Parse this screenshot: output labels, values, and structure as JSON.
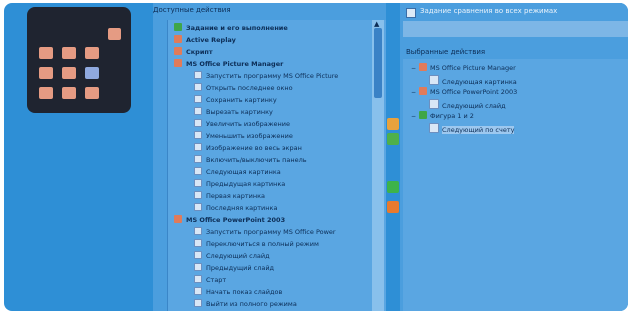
{
  "launcher": {
    "tiles": [
      {
        "name": "tile-1",
        "selected": false
      },
      {
        "name": "tile-2",
        "selected": false
      },
      {
        "name": "tile-3",
        "selected": false
      },
      {
        "name": "tile-4",
        "selected": false
      },
      {
        "name": "tile-5",
        "selected": false
      },
      {
        "name": "tile-6",
        "selected": true
      },
      {
        "name": "tile-7",
        "selected": false
      },
      {
        "name": "tile-8",
        "selected": false
      },
      {
        "name": "tile-9",
        "selected": false
      }
    ],
    "tile_color": "#e59b83",
    "selected_color": "#8fa9df"
  },
  "left_panel": {
    "title": "Доступные действия",
    "items": [
      {
        "kind": "grp",
        "icon": "ok",
        "label": "Задание и его выполнение"
      },
      {
        "kind": "grp",
        "icon": "app",
        "label": "Active Replay"
      },
      {
        "kind": "grp",
        "icon": "app",
        "label": "Скрипт"
      },
      {
        "kind": "grp",
        "icon": "app",
        "label": "MS Office Picture Manager"
      },
      {
        "kind": "sub",
        "icon": "doc",
        "label": "Запустить программу MS Office Picture"
      },
      {
        "kind": "sub",
        "icon": "doc",
        "label": "Открыть последнее окно"
      },
      {
        "kind": "sub",
        "icon": "doc",
        "label": "Сохранить картинку"
      },
      {
        "kind": "sub",
        "icon": "doc",
        "label": "Вырезать картинку"
      },
      {
        "kind": "sub",
        "icon": "doc",
        "label": "Увеличить изображение"
      },
      {
        "kind": "sub",
        "icon": "doc",
        "label": "Уменьшить изображение"
      },
      {
        "kind": "sub",
        "icon": "doc",
        "label": "Изображение во весь экран"
      },
      {
        "kind": "sub",
        "icon": "doc",
        "label": "Включить/выключить панель"
      },
      {
        "kind": "sub",
        "icon": "doc",
        "label": "Следующая картинка"
      },
      {
        "kind": "sub",
        "icon": "doc",
        "label": "Предыдущая картинка"
      },
      {
        "kind": "sub",
        "icon": "doc",
        "label": "Первая картинка"
      },
      {
        "kind": "sub",
        "icon": "doc",
        "label": "Последняя картинка"
      },
      {
        "kind": "grp",
        "icon": "app",
        "label": "MS Office PowerPoint 2003"
      },
      {
        "kind": "sub",
        "icon": "doc",
        "label": "Запустить программу MS Office Power"
      },
      {
        "kind": "sub",
        "icon": "doc",
        "label": "Переключиться в полный режим"
      },
      {
        "kind": "sub",
        "icon": "doc",
        "label": "Следующий слайд"
      },
      {
        "kind": "sub",
        "icon": "doc",
        "label": "Предыдущий слайд"
      },
      {
        "kind": "sub",
        "icon": "doc",
        "label": "Старт"
      },
      {
        "kind": "sub",
        "icon": "doc",
        "label": "Начать показ слайдов"
      },
      {
        "kind": "sub",
        "icon": "doc",
        "label": "Выйти из полного режима"
      }
    ]
  },
  "right_panel": {
    "checkbox_label": "Задание сравнения во всех режимах",
    "subtitle": "Выбранные действия",
    "tree": [
      {
        "level": 0,
        "icon": "app",
        "label": "MS Office Picture Manager",
        "expanded": true
      },
      {
        "level": 1,
        "icon": "doc",
        "label": "Следующая картинка"
      },
      {
        "level": 0,
        "icon": "app",
        "label": "MS Office PowerPoint 2003",
        "expanded": true
      },
      {
        "level": 1,
        "icon": "doc",
        "label": "Следующий слайд"
      },
      {
        "level": 0,
        "icon": "ok",
        "label": "Фигура 1 и 2",
        "expanded": true
      },
      {
        "level": 1,
        "icon": "doc",
        "label": "Следующий по счету",
        "highlight": true
      }
    ]
  },
  "middle_buttons": [
    {
      "name": "move-up-button",
      "color": "#e8a23d"
    },
    {
      "name": "move-down-button",
      "color": "#4fb04a"
    },
    {
      "name": "add-button",
      "color": "#3db34a"
    },
    {
      "name": "remove-button",
      "color": "#e87a2e"
    }
  ]
}
